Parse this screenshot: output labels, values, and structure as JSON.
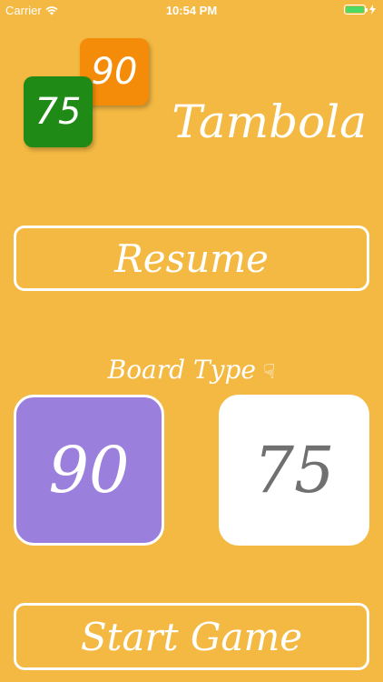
{
  "status": {
    "carrier": "Carrier",
    "time": "10:54 PM"
  },
  "logo": {
    "tile_back": "90",
    "tile_front": "75",
    "tile_back_color": "#F48C0A",
    "tile_front_color": "#1F8A16"
  },
  "app": {
    "title": "Tambola",
    "background": "#F4B942"
  },
  "resume": {
    "label": "Resume"
  },
  "board": {
    "heading": "Board Type",
    "hand_icon": "pointing-hand-icon",
    "options": [
      {
        "label": "90",
        "selected": true,
        "color": "#9B7FDD"
      },
      {
        "label": "75",
        "selected": false,
        "color": "#FFFFFF"
      }
    ]
  },
  "start": {
    "label": "Start Game"
  }
}
